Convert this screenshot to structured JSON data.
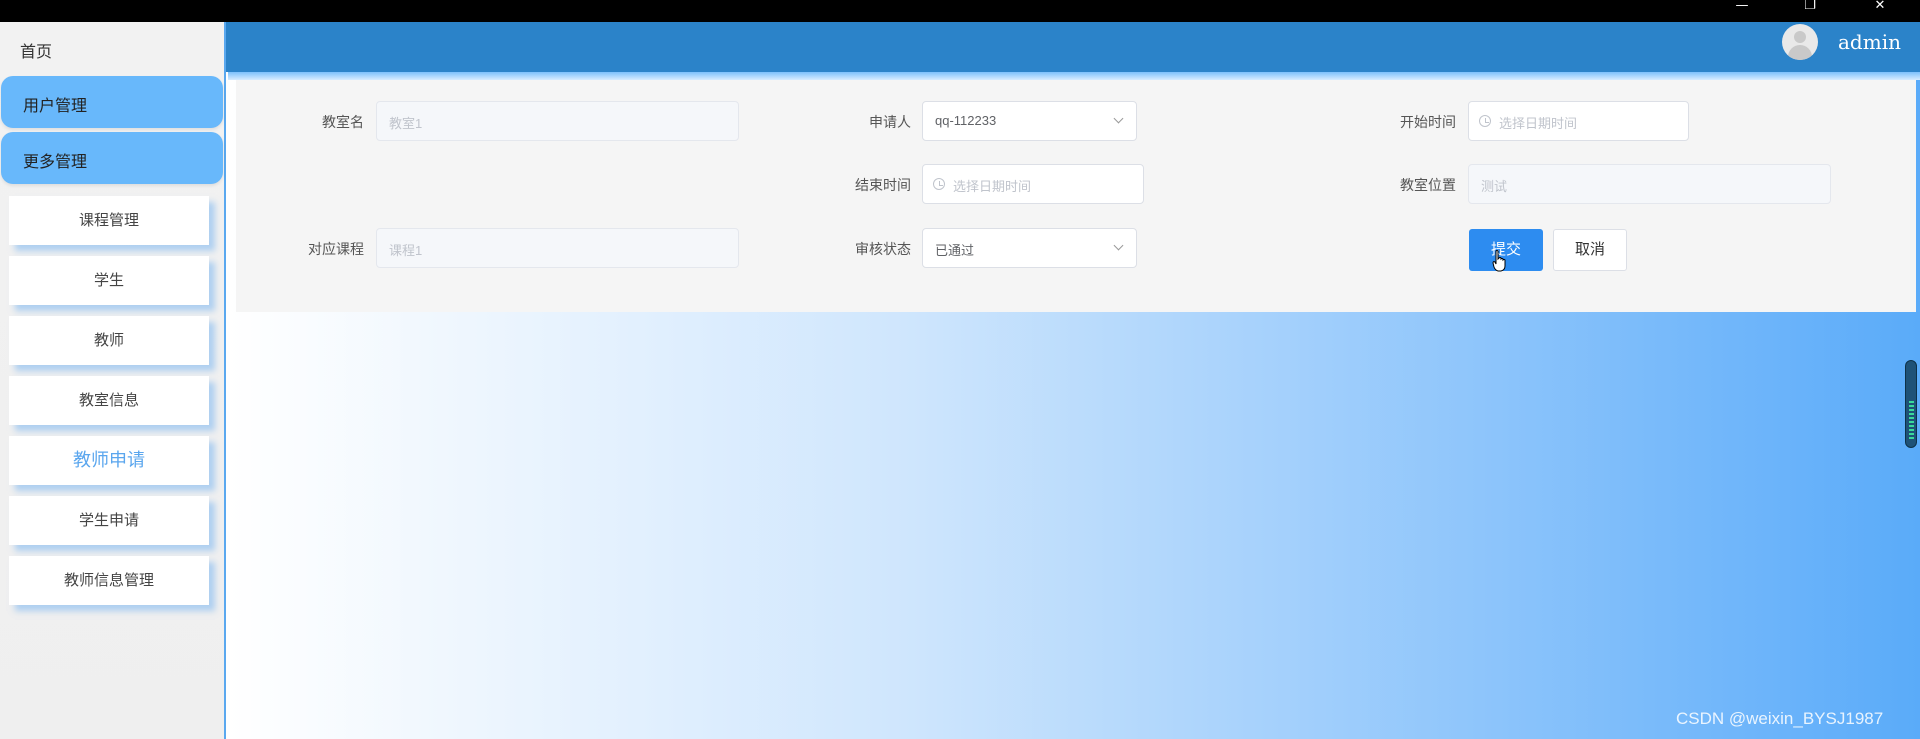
{
  "window": {
    "minimize_glyph": "—",
    "maximize_glyph": "❐",
    "close_glyph": "✕"
  },
  "sidebar": {
    "home": "首页",
    "groups": [
      {
        "label": "用户管理"
      },
      {
        "label": "更多管理"
      }
    ],
    "items": [
      {
        "label": "课程管理"
      },
      {
        "label": "学生"
      },
      {
        "label": "教师"
      },
      {
        "label": "教室信息"
      },
      {
        "label": "教师申请"
      },
      {
        "label": "学生申请"
      },
      {
        "label": "教师信息管理"
      }
    ],
    "active_item": "教师申请"
  },
  "header": {
    "username": "admin"
  },
  "form": {
    "classroom_name": {
      "label": "教室名",
      "placeholder": "教室1"
    },
    "applicant": {
      "label": "申请人",
      "value": "qq-112233"
    },
    "start_time": {
      "label": "开始时间",
      "placeholder": "选择日期时间"
    },
    "end_time": {
      "label": "结束时间",
      "placeholder": "选择日期时间"
    },
    "classroom_location": {
      "label": "教室位置",
      "placeholder": "测试"
    },
    "course": {
      "label": "对应课程",
      "placeholder": "课程1"
    },
    "review_status": {
      "label": "审核状态",
      "value": "已通过"
    },
    "submit_label": "提交",
    "cancel_label": "取消"
  },
  "watermark": "CSDN @weixin_BYSJ1987",
  "colors": {
    "header": "#2b83c9",
    "sidebar_group": "#68b8fb",
    "primary_button": "#2d8cf0",
    "active_text": "#5aa6ee"
  }
}
